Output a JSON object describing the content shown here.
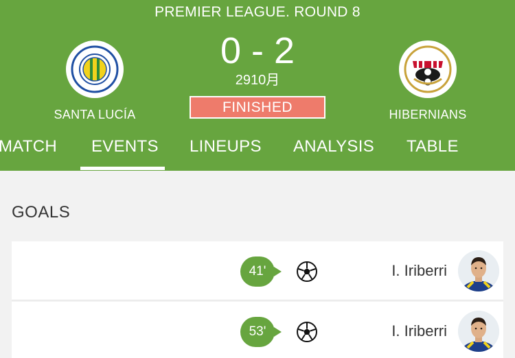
{
  "match": {
    "league": "PREMIER LEAGUE. ROUND 8",
    "score": "0 - 2",
    "date": "2910月",
    "status": "FINISHED",
    "home_team": "SANTA LUCÍA",
    "away_team": "HIBERNIANS"
  },
  "tabs": [
    {
      "label": "MATCH"
    },
    {
      "label": "EVENTS",
      "active": true
    },
    {
      "label": "LINEUPS"
    },
    {
      "label": "ANALYSIS"
    },
    {
      "label": "TABLE"
    }
  ],
  "goals": {
    "title": "GOALS",
    "items": [
      {
        "minute": "41'",
        "player": "I. Iriberri"
      },
      {
        "minute": "53'",
        "player": "I. Iriberri"
      }
    ]
  },
  "colors": {
    "header": "#67a53f",
    "status": "#ee7b6b",
    "home_crest": "#f2d21c",
    "away_crest": "#c8102e"
  },
  "icons": {
    "goal": "soccer-ball-icon",
    "home_crest": "santa-lucia-crest-icon",
    "away_crest": "hibernians-crest-icon"
  }
}
